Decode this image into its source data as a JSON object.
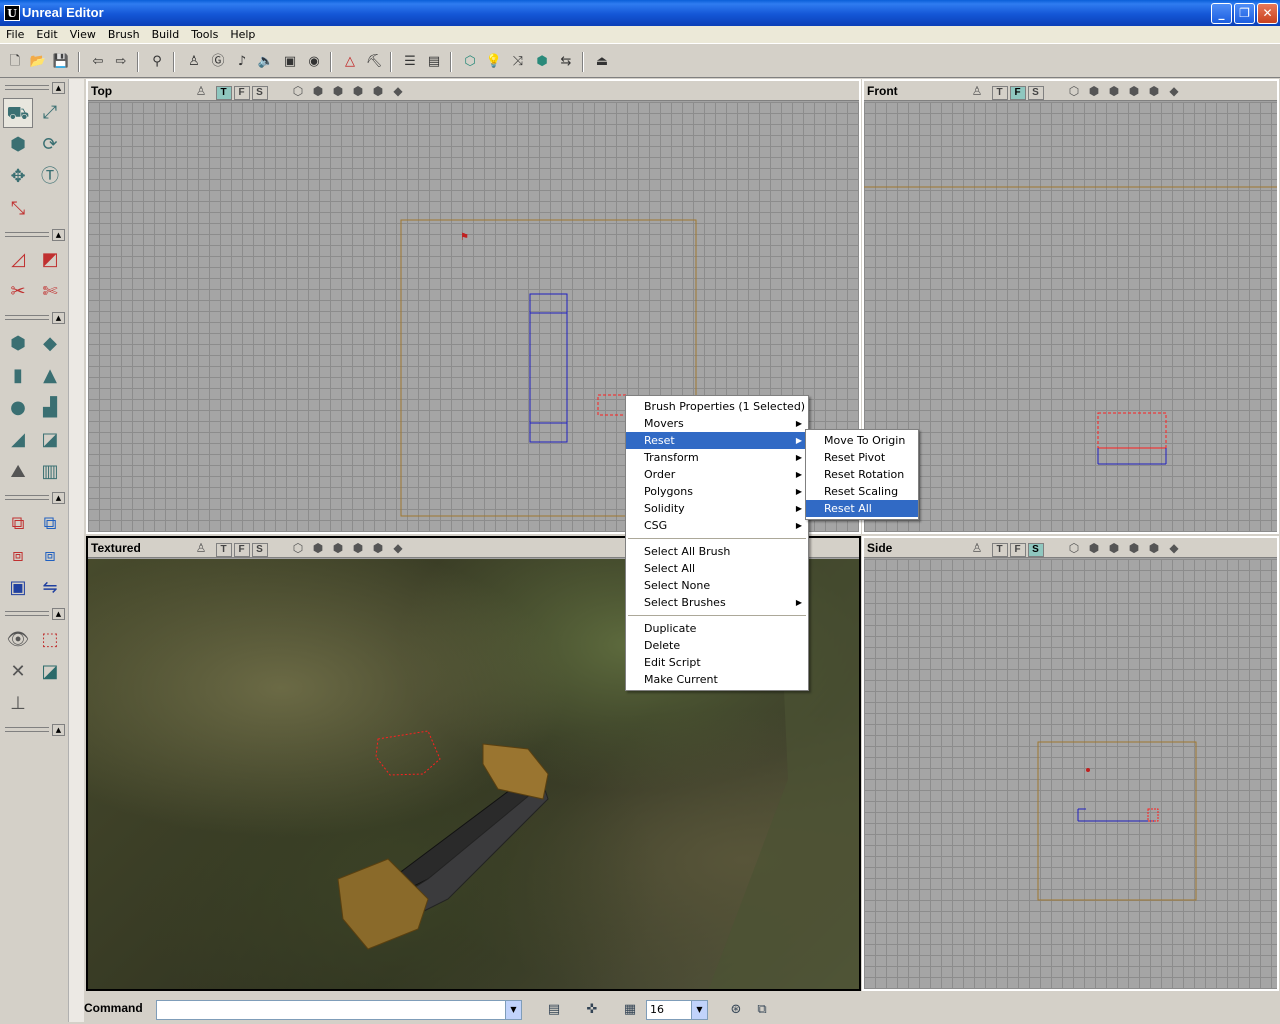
{
  "window": {
    "title": "Unreal Editor",
    "icon": "unreal-logo-icon",
    "minimize": "_",
    "maximize": "❐",
    "close": "✕"
  },
  "menubar": [
    "File",
    "Edit",
    "View",
    "Brush",
    "Build",
    "Tools",
    "Help"
  ],
  "toolbar": [
    "new-map-icon",
    "open-map-icon",
    "save-map-icon",
    "undo-icon",
    "redo-icon",
    "search-actors-icon",
    "actor-browser-icon",
    "group-browser-icon",
    "music-browser-icon",
    "sound-browser-icon",
    "texture-browser-icon",
    "mesh-viewer-icon",
    "build-geometry-icon",
    "build-lighting-icon",
    "build-options-icon",
    "actor-list-icon",
    "build-all-icon",
    "light-icon",
    "paths-icon",
    "build-changed-icon",
    "properties-icon",
    "play-level-icon"
  ],
  "viewports": {
    "top": {
      "name": "Top",
      "active_flag": "T"
    },
    "front": {
      "name": "Front",
      "active_flag": "F"
    },
    "textured": {
      "name": "Textured",
      "active_flag": ""
    },
    "side": {
      "name": "Side",
      "active_flag": "S"
    },
    "flags": [
      "T",
      "F",
      "S"
    ]
  },
  "context_menu": {
    "items": [
      {
        "label": "Brush Properties (1 Selected)",
        "submenu": false
      },
      {
        "label": "Movers",
        "submenu": true
      },
      {
        "label": "Reset",
        "submenu": true,
        "highlighted": true
      },
      {
        "label": "Transform",
        "submenu": true
      },
      {
        "label": "Order",
        "submenu": true
      },
      {
        "label": "Polygons",
        "submenu": true
      },
      {
        "label": "Solidity",
        "submenu": true
      },
      {
        "label": "CSG",
        "submenu": true
      },
      {
        "separator": true
      },
      {
        "label": "Select All Brush",
        "submenu": false
      },
      {
        "label": "Select All",
        "submenu": false
      },
      {
        "label": "Select None",
        "submenu": false
      },
      {
        "label": "Select Brushes",
        "submenu": true
      },
      {
        "separator": true
      },
      {
        "label": "Duplicate",
        "submenu": false
      },
      {
        "label": "Delete",
        "submenu": false
      },
      {
        "label": "Edit Script",
        "submenu": false
      },
      {
        "label": "Make Current",
        "submenu": false
      }
    ],
    "reset_submenu": [
      {
        "label": "Move To Origin"
      },
      {
        "label": "Reset Pivot"
      },
      {
        "label": "Reset Rotation"
      },
      {
        "label": "Reset Scaling"
      },
      {
        "label": "Reset All",
        "highlighted": true
      }
    ]
  },
  "command_bar": {
    "label": "Command",
    "value": "",
    "grid_size": "16"
  },
  "colors": {
    "accent": "#316ac5",
    "brush_red": "#ff2020",
    "builder_blue": "#2020c0",
    "bounds_orange": "#a07830"
  }
}
